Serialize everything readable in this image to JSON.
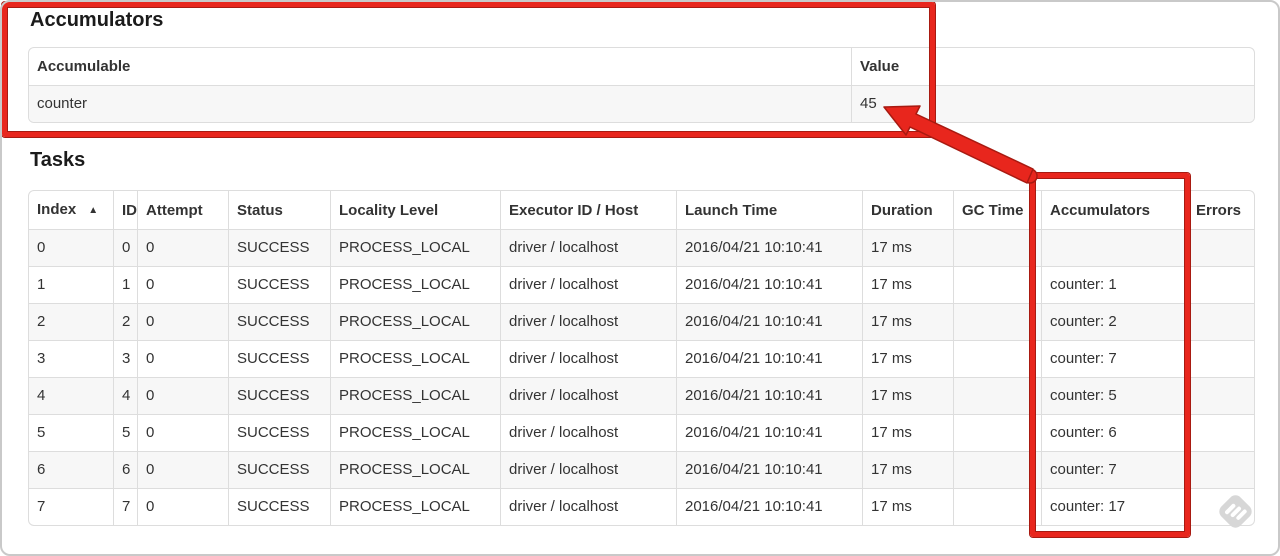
{
  "colors": {
    "annotation_red": "#e8261d",
    "annotation_red_dark": "#a81a11"
  },
  "accumulators_section": {
    "heading": "Accumulators",
    "table": {
      "headers": [
        "Accumulable",
        "Value"
      ],
      "rows": [
        [
          "counter",
          "45"
        ]
      ]
    }
  },
  "tasks_section": {
    "heading": "Tasks",
    "sort_icon": "▲",
    "table": {
      "headers": [
        "Index",
        "ID",
        "Attempt",
        "Status",
        "Locality Level",
        "Executor ID / Host",
        "Launch Time",
        "Duration",
        "GC Time",
        "Accumulators",
        "Errors"
      ],
      "rows": [
        [
          "0",
          "0",
          "0",
          "SUCCESS",
          "PROCESS_LOCAL",
          "driver / localhost",
          "2016/04/21 10:10:41",
          "17 ms",
          "",
          "",
          ""
        ],
        [
          "1",
          "1",
          "0",
          "SUCCESS",
          "PROCESS_LOCAL",
          "driver / localhost",
          "2016/04/21 10:10:41",
          "17 ms",
          "",
          "counter: 1",
          ""
        ],
        [
          "2",
          "2",
          "0",
          "SUCCESS",
          "PROCESS_LOCAL",
          "driver / localhost",
          "2016/04/21 10:10:41",
          "17 ms",
          "",
          "counter: 2",
          ""
        ],
        [
          "3",
          "3",
          "0",
          "SUCCESS",
          "PROCESS_LOCAL",
          "driver / localhost",
          "2016/04/21 10:10:41",
          "17 ms",
          "",
          "counter: 7",
          ""
        ],
        [
          "4",
          "4",
          "0",
          "SUCCESS",
          "PROCESS_LOCAL",
          "driver / localhost",
          "2016/04/21 10:10:41",
          "17 ms",
          "",
          "counter: 5",
          ""
        ],
        [
          "5",
          "5",
          "0",
          "SUCCESS",
          "PROCESS_LOCAL",
          "driver / localhost",
          "2016/04/21 10:10:41",
          "17 ms",
          "",
          "counter: 6",
          ""
        ],
        [
          "6",
          "6",
          "0",
          "SUCCESS",
          "PROCESS_LOCAL",
          "driver / localhost",
          "2016/04/21 10:10:41",
          "17 ms",
          "",
          "counter: 7",
          ""
        ],
        [
          "7",
          "7",
          "0",
          "SUCCESS",
          "PROCESS_LOCAL",
          "driver / localhost",
          "2016/04/21 10:10:41",
          "17 ms",
          "",
          "counter: 17",
          ""
        ]
      ]
    }
  }
}
